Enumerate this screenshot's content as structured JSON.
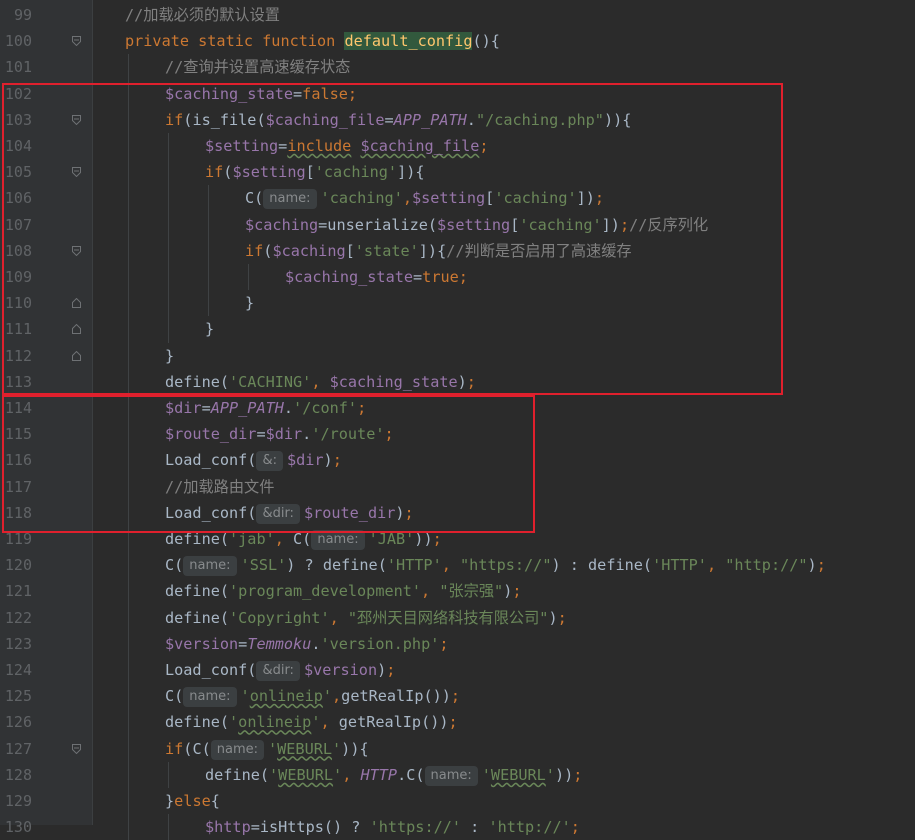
{
  "editor": {
    "language": "php",
    "theme_colors": {
      "background": "#2b2b2b",
      "keyword": "#cc7832",
      "variable": "#9876aa",
      "string": "#6a8759",
      "comment": "#808080",
      "function_highlight": "#ffc66d",
      "annotation_box": "#e0202d"
    },
    "lines": [
      {
        "num": "99",
        "indent": 1,
        "fold": "",
        "tokens": [
          [
            "cmt",
            "//加载必须的默认设置"
          ]
        ]
      },
      {
        "num": "100",
        "indent": 1,
        "fold": "open",
        "tokens": [
          [
            "kw",
            "private static function "
          ],
          [
            "fn",
            "default_config"
          ],
          [
            "",
            "(){"
          ]
        ]
      },
      {
        "num": "101",
        "indent": 2,
        "fold": "",
        "tokens": [
          [
            "cmt",
            "//查询并设置高速缓存状态"
          ]
        ]
      },
      {
        "num": "102",
        "indent": 2,
        "fold": "",
        "tokens": [
          [
            "var",
            "$caching_state"
          ],
          [
            "",
            "="
          ],
          [
            "kw",
            "false"
          ],
          [
            "kw",
            ";"
          ]
        ]
      },
      {
        "num": "103",
        "indent": 2,
        "fold": "open",
        "tokens": [
          [
            "kw",
            "if"
          ],
          [
            "",
            "(is_file("
          ],
          [
            "var",
            "$caching_file"
          ],
          [
            "",
            "="
          ],
          [
            "cnst",
            "APP_PATH"
          ],
          [
            "",
            "."
          ],
          [
            "str",
            "\"/caching.php\""
          ],
          [
            "",
            ")){"
          ]
        ]
      },
      {
        "num": "104",
        "indent": 3,
        "fold": "",
        "tokens": [
          [
            "var",
            "$setting"
          ],
          [
            "",
            "="
          ],
          [
            "kw warn",
            "include"
          ],
          [
            "",
            " "
          ],
          [
            "var warn",
            "$caching_file"
          ],
          [
            "kw",
            ";"
          ]
        ]
      },
      {
        "num": "105",
        "indent": 3,
        "fold": "open",
        "tokens": [
          [
            "kw",
            "if"
          ],
          [
            "",
            "("
          ],
          [
            "var",
            "$setting"
          ],
          [
            "",
            "["
          ],
          [
            "str",
            "'caching'"
          ],
          [
            "",
            "]){"
          ]
        ]
      },
      {
        "num": "106",
        "indent": 4,
        "fold": "",
        "tokens": [
          [
            "",
            "C("
          ],
          [
            "hint",
            "name:"
          ],
          [
            "str",
            "'caching'"
          ],
          [
            "kw",
            ","
          ],
          [
            "var",
            "$setting"
          ],
          [
            "",
            "["
          ],
          [
            "str",
            "'caching'"
          ],
          [
            "",
            "])"
          ],
          [
            "kw",
            ";"
          ]
        ]
      },
      {
        "num": "107",
        "indent": 4,
        "fold": "",
        "tokens": [
          [
            "var",
            "$caching"
          ],
          [
            "",
            "=unserialize("
          ],
          [
            "var",
            "$setting"
          ],
          [
            "",
            "["
          ],
          [
            "str",
            "'caching'"
          ],
          [
            "",
            "])"
          ],
          [
            "kw",
            ";"
          ],
          [
            "cmt",
            "//反序列化"
          ]
        ]
      },
      {
        "num": "108",
        "indent": 4,
        "fold": "open",
        "tokens": [
          [
            "kw",
            "if"
          ],
          [
            "",
            "("
          ],
          [
            "var",
            "$caching"
          ],
          [
            "",
            "["
          ],
          [
            "str",
            "'state'"
          ],
          [
            "",
            "]){"
          ],
          [
            "cmt",
            "//判断是否启用了高速缓存"
          ]
        ]
      },
      {
        "num": "109",
        "indent": 5,
        "fold": "",
        "tokens": [
          [
            "var",
            "$caching_state"
          ],
          [
            "",
            "="
          ],
          [
            "kw",
            "true"
          ],
          [
            "kw",
            ";"
          ]
        ]
      },
      {
        "num": "110",
        "indent": 4,
        "fold": "close",
        "tokens": [
          [
            "",
            "}"
          ]
        ]
      },
      {
        "num": "111",
        "indent": 3,
        "fold": "close",
        "tokens": [
          [
            "",
            "}"
          ]
        ]
      },
      {
        "num": "112",
        "indent": 2,
        "fold": "close",
        "tokens": [
          [
            "",
            "}"
          ]
        ]
      },
      {
        "num": "113",
        "indent": 2,
        "fold": "",
        "tokens": [
          [
            "",
            "define("
          ],
          [
            "str",
            "'CACHING'"
          ],
          [
            "kw",
            ", "
          ],
          [
            "var",
            "$caching_state"
          ],
          [
            "",
            ")"
          ],
          [
            "kw",
            ";"
          ]
        ]
      },
      {
        "num": "114",
        "indent": 2,
        "fold": "",
        "tokens": [
          [
            "var",
            "$dir"
          ],
          [
            "",
            "="
          ],
          [
            "cnst",
            "APP_PATH"
          ],
          [
            "",
            "."
          ],
          [
            "str",
            "'/conf'"
          ],
          [
            "kw",
            ";"
          ]
        ]
      },
      {
        "num": "115",
        "indent": 2,
        "fold": "",
        "tokens": [
          [
            "var",
            "$route_dir"
          ],
          [
            "",
            "="
          ],
          [
            "var",
            "$dir"
          ],
          [
            "",
            "."
          ],
          [
            "str",
            "'/route'"
          ],
          [
            "kw",
            ";"
          ]
        ]
      },
      {
        "num": "116",
        "indent": 2,
        "fold": "",
        "tokens": [
          [
            "",
            "Load_conf("
          ],
          [
            "hint",
            "&:"
          ],
          [
            "var",
            "$dir"
          ],
          [
            "",
            ")"
          ],
          [
            "kw",
            ";"
          ]
        ]
      },
      {
        "num": "117",
        "indent": 2,
        "fold": "",
        "tokens": [
          [
            "cmt",
            "//加载路由文件"
          ]
        ]
      },
      {
        "num": "118",
        "indent": 2,
        "fold": "",
        "tokens": [
          [
            "",
            "Load_conf("
          ],
          [
            "hint",
            "&dir:"
          ],
          [
            "var",
            "$route_dir"
          ],
          [
            "",
            ")"
          ],
          [
            "kw",
            ";"
          ]
        ]
      },
      {
        "num": "119",
        "indent": 2,
        "fold": "",
        "tokens": [
          [
            "",
            "define("
          ],
          [
            "str",
            "'jab'"
          ],
          [
            "kw",
            ", "
          ],
          [
            "",
            "C("
          ],
          [
            "hint",
            "name:"
          ],
          [
            "str",
            "'JAB'"
          ],
          [
            "",
            "))"
          ],
          [
            "kw",
            ";"
          ]
        ]
      },
      {
        "num": "120",
        "indent": 2,
        "fold": "",
        "tokens": [
          [
            "",
            "C("
          ],
          [
            "hint",
            "name:"
          ],
          [
            "str",
            "'SSL'"
          ],
          [
            "",
            ") ? define("
          ],
          [
            "str",
            "'HTTP'"
          ],
          [
            "kw",
            ", "
          ],
          [
            "str",
            "\"https://\""
          ],
          [
            "",
            ") : define("
          ],
          [
            "str",
            "'HTTP'"
          ],
          [
            "kw",
            ", "
          ],
          [
            "str",
            "\"http://\""
          ],
          [
            "",
            ")"
          ],
          [
            "kw",
            ";"
          ]
        ]
      },
      {
        "num": "121",
        "indent": 2,
        "fold": "",
        "tokens": [
          [
            "",
            "define("
          ],
          [
            "str",
            "'program_development'"
          ],
          [
            "kw",
            ", "
          ],
          [
            "str",
            "\"张宗强\""
          ],
          [
            "",
            ")"
          ],
          [
            "kw",
            ";"
          ]
        ]
      },
      {
        "num": "122",
        "indent": 2,
        "fold": "",
        "tokens": [
          [
            "",
            "define("
          ],
          [
            "str",
            "'Copyright'"
          ],
          [
            "kw",
            ", "
          ],
          [
            "str",
            "\"邳州天目网络科技有限公司\""
          ],
          [
            "",
            ")"
          ],
          [
            "kw",
            ";"
          ]
        ]
      },
      {
        "num": "123",
        "indent": 2,
        "fold": "",
        "tokens": [
          [
            "var",
            "$version"
          ],
          [
            "",
            "="
          ],
          [
            "cnst",
            "Temmoku"
          ],
          [
            "",
            "."
          ],
          [
            "str",
            "'version.php'"
          ],
          [
            "kw",
            ";"
          ]
        ]
      },
      {
        "num": "124",
        "indent": 2,
        "fold": "",
        "tokens": [
          [
            "",
            "Load_conf("
          ],
          [
            "hint",
            "&dir:"
          ],
          [
            "var",
            "$version"
          ],
          [
            "",
            ")"
          ],
          [
            "kw",
            ";"
          ]
        ]
      },
      {
        "num": "125",
        "indent": 2,
        "fold": "",
        "tokens": [
          [
            "",
            "C("
          ],
          [
            "hint",
            "name:"
          ],
          [
            "str",
            "'"
          ],
          [
            "str warn",
            "onlineip"
          ],
          [
            "str",
            "'"
          ],
          [
            "kw",
            ","
          ],
          [
            "",
            "getRealIp())"
          ],
          [
            "kw",
            ";"
          ]
        ]
      },
      {
        "num": "126",
        "indent": 2,
        "fold": "",
        "tokens": [
          [
            "",
            "define("
          ],
          [
            "str",
            "'"
          ],
          [
            "str warn",
            "onlineip"
          ],
          [
            "str",
            "'"
          ],
          [
            "kw",
            ", "
          ],
          [
            "",
            "getRealIp())"
          ],
          [
            "kw",
            ";"
          ]
        ]
      },
      {
        "num": "127",
        "indent": 2,
        "fold": "open",
        "tokens": [
          [
            "kw",
            "if"
          ],
          [
            "",
            "(C("
          ],
          [
            "hint",
            "name:"
          ],
          [
            "str",
            "'"
          ],
          [
            "str warn",
            "WEBURL"
          ],
          [
            "str",
            "'"
          ],
          [
            "",
            ")){"
          ]
        ]
      },
      {
        "num": "128",
        "indent": 3,
        "fold": "",
        "tokens": [
          [
            "",
            "define("
          ],
          [
            "str",
            "'"
          ],
          [
            "str warn",
            "WEBURL"
          ],
          [
            "str",
            "'"
          ],
          [
            "kw",
            ", "
          ],
          [
            "cnst",
            "HTTP"
          ],
          [
            "",
            ".C("
          ],
          [
            "hint",
            "name:"
          ],
          [
            "str",
            "'"
          ],
          [
            "str warn",
            "WEBURL"
          ],
          [
            "str",
            "'"
          ],
          [
            "",
            "))"
          ],
          [
            "kw",
            ";"
          ]
        ]
      },
      {
        "num": "129",
        "indent": 2,
        "fold": "",
        "tokens": [
          [
            "",
            "}"
          ],
          [
            "kw",
            "else"
          ],
          [
            "",
            "{"
          ]
        ]
      },
      {
        "num": "130",
        "indent": 3,
        "fold": "",
        "tokens": [
          [
            "var",
            "$http"
          ],
          [
            "",
            "=isHttps() ? "
          ],
          [
            "str",
            "'https://'"
          ],
          [
            "",
            " : "
          ],
          [
            "str",
            "'http://'"
          ],
          [
            "kw",
            ";"
          ]
        ]
      }
    ]
  }
}
